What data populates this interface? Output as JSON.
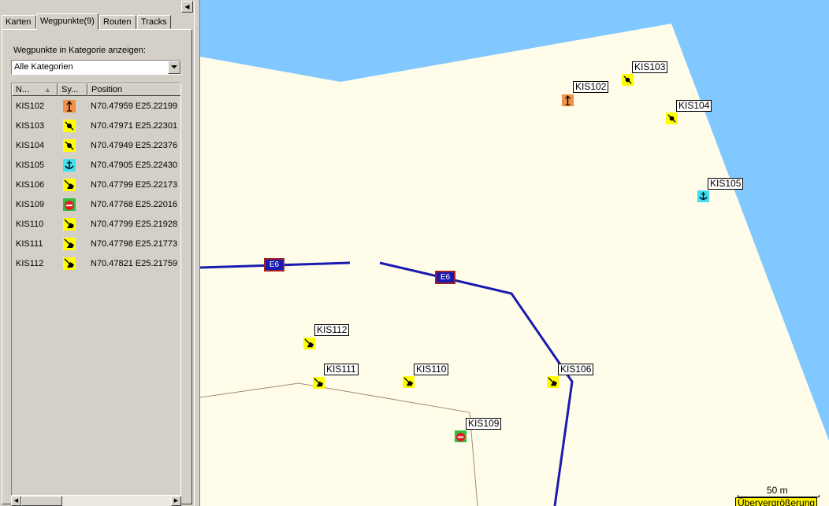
{
  "tabs": [
    {
      "label": "Karten"
    },
    {
      "label": "Wegpunkte(9)"
    },
    {
      "label": "Routen"
    },
    {
      "label": "Tracks"
    }
  ],
  "category": {
    "label": "Wegpunkte in Kategorie anzeigen:",
    "selected": "Alle Kategorien"
  },
  "list": {
    "columns": [
      "N...",
      "Sy...",
      "Position"
    ],
    "rows": [
      {
        "name": "KIS102",
        "symbol": "tower-icon",
        "position": "N70.47959 E25.22199"
      },
      {
        "name": "KIS103",
        "symbol": "pin-icon",
        "position": "N70.47971 E25.22301"
      },
      {
        "name": "KIS104",
        "symbol": "pin-icon",
        "position": "N70.47949 E25.22376"
      },
      {
        "name": "KIS105",
        "symbol": "anchor-icon",
        "position": "N70.47905 E25.22430"
      },
      {
        "name": "KIS106",
        "symbol": "tent-icon",
        "position": "N70.47799 E25.22173"
      },
      {
        "name": "KIS109",
        "symbol": "no-entry-icon",
        "position": "N70.47768 E25.22016"
      },
      {
        "name": "KIS110",
        "symbol": "tent-icon",
        "position": "N70.47799 E25.21928"
      },
      {
        "name": "KIS111",
        "symbol": "tent-icon",
        "position": "N70.47798 E25.21773"
      },
      {
        "name": "KIS112",
        "symbol": "tent-icon",
        "position": "N70.47821 E25.21759"
      }
    ]
  },
  "map": {
    "waypoints": [
      {
        "label": "KIS102",
        "symbol": "tower-icon"
      },
      {
        "label": "KIS103",
        "symbol": "pin-icon"
      },
      {
        "label": "KIS104",
        "symbol": "pin-icon"
      },
      {
        "label": "KIS105",
        "symbol": "anchor-icon"
      },
      {
        "label": "KIS112",
        "symbol": "tent-icon"
      },
      {
        "label": "KIS111",
        "symbol": "tent-icon"
      },
      {
        "label": "KIS110",
        "symbol": "tent-icon"
      },
      {
        "label": "KIS106",
        "symbol": "tent-icon"
      },
      {
        "label": "KIS109",
        "symbol": "no-entry-icon"
      }
    ],
    "road_label": "E6",
    "scale": "50 m",
    "over_zoom": "Übervergrößerung",
    "colors": {
      "water": "#80c8ff",
      "land": "#fffde9",
      "road": "#1a1ab0",
      "path": "#a08c6e",
      "symbol_yellow": "#ffff00",
      "symbol_orange": "#f0904a",
      "symbol_cyan": "#40e0f0",
      "symbol_green": "#30c040"
    }
  }
}
